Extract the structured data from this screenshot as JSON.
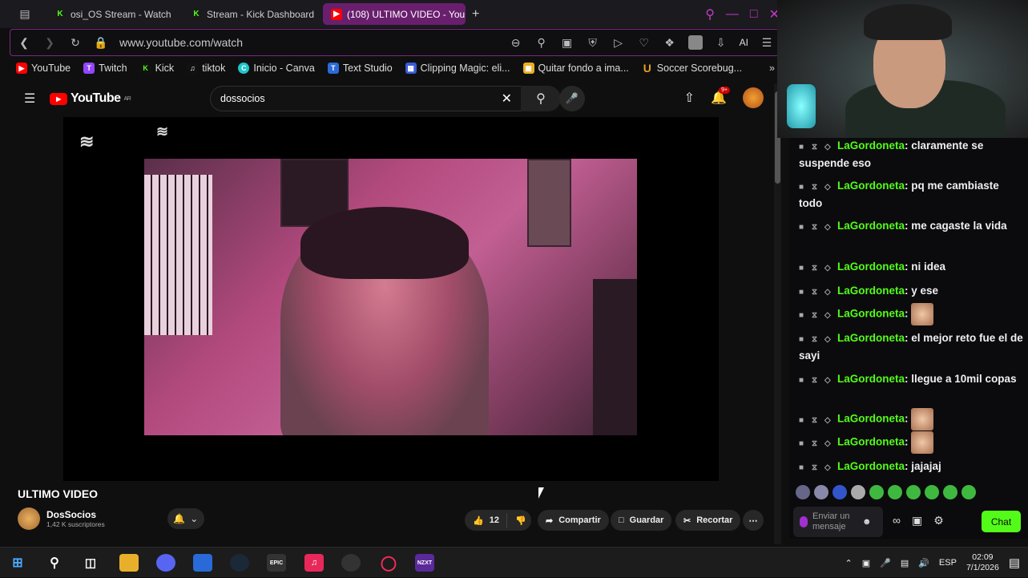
{
  "browser": {
    "tabs": [
      {
        "label": "osi_OS Stream - Watch",
        "type": "kick"
      },
      {
        "label": "Stream - Kick Dashboard",
        "type": "kick"
      },
      {
        "label": "(108) ULTIMO VIDEO - You",
        "type": "youtube",
        "active": true
      }
    ],
    "new_tab": "+",
    "url": "www.youtube.com/watch",
    "ai_label": "AI",
    "bookmarks": [
      "YouTube",
      "Twitch",
      "Kick",
      "tiktok",
      "Inicio - Canva",
      "Text Studio",
      "Clipping Magic: eli...",
      "Quitar fondo a ima...",
      "Soccer Scorebug..."
    ],
    "accent": "#c03cc4"
  },
  "youtube": {
    "logo": "YouTube",
    "region": "AR",
    "search_value": "dossocios",
    "notification_count": "9+",
    "video_title": "ULTIMO VIDEO",
    "channel_name": "DosSocios",
    "subscribers": "1,42 K suscriptores",
    "likes": "12",
    "share": "Compartir",
    "save": "Guardar",
    "clip": "Recortar"
  },
  "chat": {
    "username_color": "#53fc18",
    "messages": [
      {
        "user": "LaGordoneta",
        "text": "claramente se suspende eso"
      },
      {
        "user": "LaGordoneta",
        "text": "pq me cambiaste todo"
      },
      {
        "user": "LaGordoneta",
        "text": "me cagaste la vida"
      },
      {
        "user": "LaGordoneta",
        "text": "ni idea"
      },
      {
        "user": "LaGordoneta",
        "text": "y ese"
      },
      {
        "user": "LaGordoneta",
        "text": "",
        "emote": true
      },
      {
        "user": "LaGordoneta",
        "text": "el mejor reto fue el de sayi"
      },
      {
        "user": "LaGordoneta",
        "text": "llegue a 10mil copas"
      },
      {
        "user": "LaGordoneta",
        "text": "",
        "emote": true
      },
      {
        "user": "LaGordoneta",
        "text": "",
        "emote": true
      },
      {
        "user": "LaGordoneta",
        "text": "jajajaj"
      }
    ],
    "input_placeholder": "Enviar un mensaje",
    "chat_button": "Chat"
  },
  "taskbar": {
    "lang": "ESP",
    "time": "02:09",
    "date": "7/1/2026"
  }
}
